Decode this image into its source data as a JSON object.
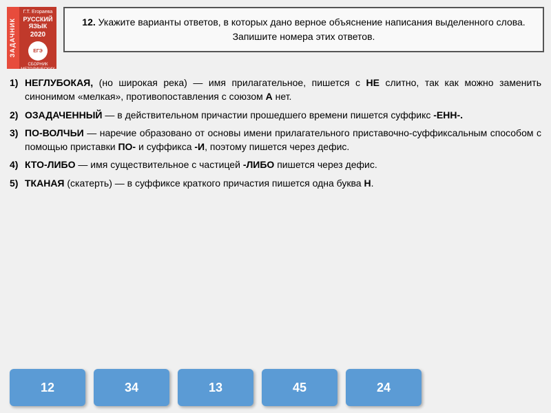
{
  "book": {
    "author": "Г.Т. Егораева",
    "title": "РУССКИЙ ЯЗЫК",
    "year": "2020",
    "series": "ЗАДАЧНИК",
    "subtitle": "СБОРНИК\nМЕТОДИЧЕСКИХ\nРЕКОМЕНДАЦИЙ",
    "side_label": "ЗАДАЧНИК"
  },
  "question": {
    "number": "12.",
    "text": "Укажите варианты ответов, в которых дано верное объяснение написания выделенного слова. Запишите номера этих ответов."
  },
  "items": [
    {
      "number": "1)",
      "text_html": "<b>НЕГЛУБОКАЯ,</b> <b>(</b>но широкая река) — имя прилагательное, пишется с <b>НЕ</b> слитно, так как можно заменить синонимом «мелкая», противопоставления с союзом <b>А</b> нет."
    },
    {
      "number": "2)",
      "text_html": "<b>ОЗАДАЧЕННЫЙ</b> — в действительном причастии прошедшего времени пишется суффикс <b>-ЕНН-.</b>"
    },
    {
      "number": "3)",
      "text_html": "<b>ПО-ВОЛЧЬИ</b> — наречие образовано от основы имени прилагательного приставочно-суффиксальным способом с помощью приставки <b>ПО-</b> и суффикса <b>-И</b>, поэтому пишется через дефис."
    },
    {
      "number": "4)",
      "text_html": "<b>КТО-ЛИБО</b> — имя существительное с частицей <b>-ЛИБО</b> пишется через дефис."
    },
    {
      "number": "5)",
      "text_html": "<b>ТКАНАЯ</b> (скатерть) — в суффиксе краткого причастия пишется одна буква <b>Н</b>."
    }
  ],
  "answers": [
    {
      "label": "12"
    },
    {
      "label": "34"
    },
    {
      "label": "13"
    },
    {
      "label": "45"
    },
    {
      "label": "24"
    }
  ]
}
